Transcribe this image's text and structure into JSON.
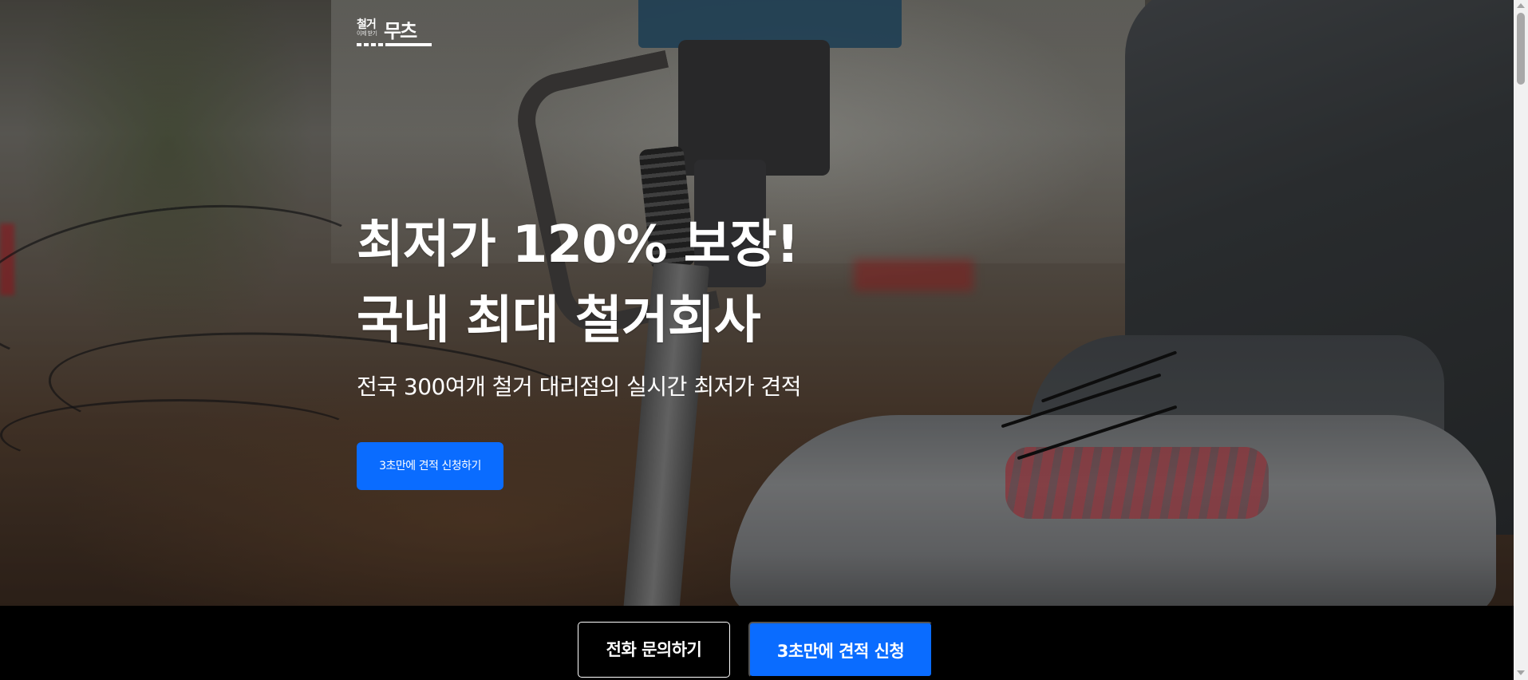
{
  "brand": {
    "logo_small": "철거",
    "logo_small_sub": "이제 받기",
    "logo_big": "무츠"
  },
  "hero": {
    "headline_line1": "최저가 120% 보장!",
    "headline_line2": "국내 최대 철거회사",
    "subheadline": "전국 300여개 철거 대리점의 실시간 최저가 견적",
    "cta_label": "3초만에 견적 신청하기",
    "background_image": "demolition-jackhammer-boot-photo"
  },
  "bottom_bar": {
    "call_label": "전화 문의하기",
    "quote_label": "3초만에 견적 신청"
  },
  "colors": {
    "accent": "#0a6cff",
    "bar_background": "#000000",
    "text": "#ffffff"
  },
  "scrollbar": {
    "icon_up": "chevron-up-icon",
    "icon_down": "chevron-down-icon"
  }
}
